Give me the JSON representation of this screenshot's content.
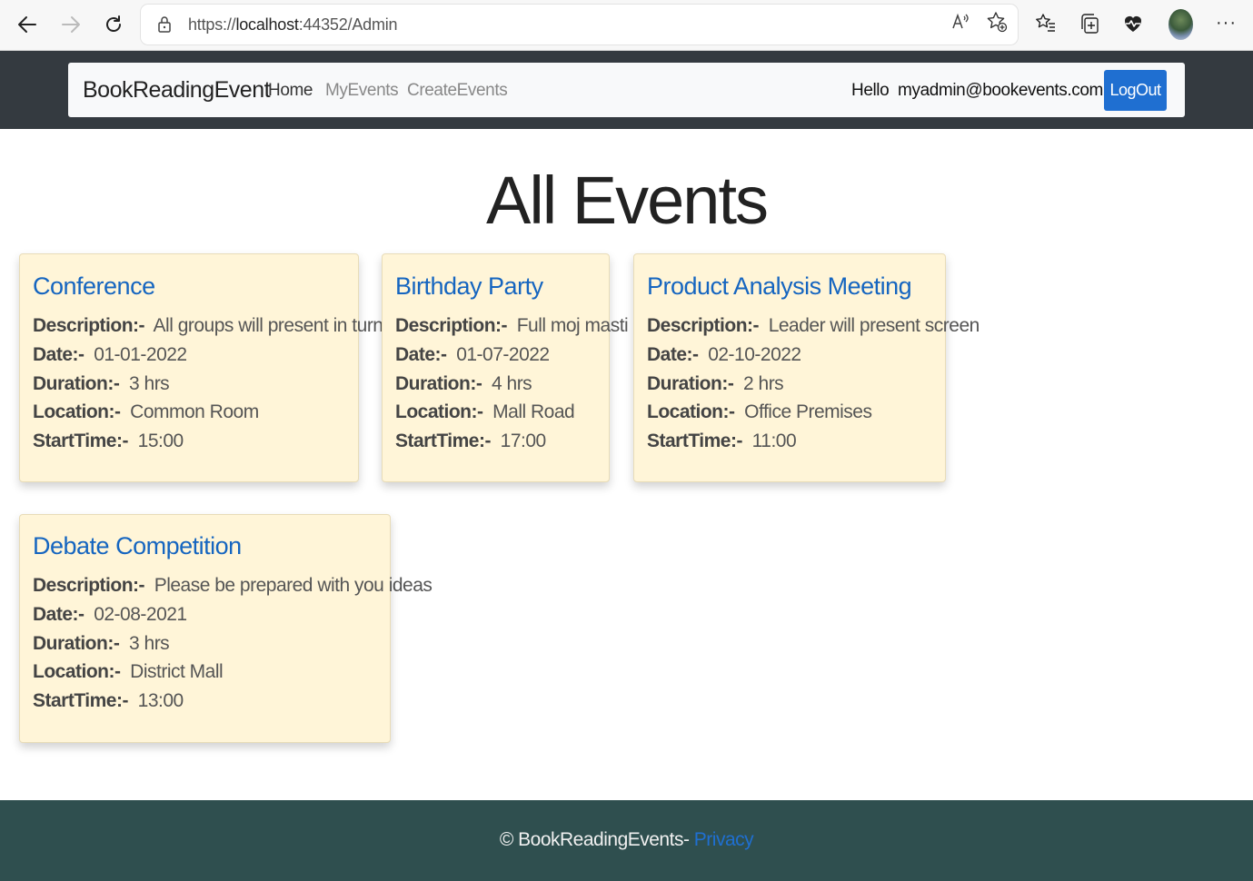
{
  "browser": {
    "url_scheme": "https://",
    "url_host": "localhost",
    "url_rest": ":44352/Admin",
    "icons": [
      "back-icon",
      "forward-icon",
      "refresh-icon",
      "lock-icon",
      "read-aloud-icon",
      "add-favorite-icon",
      "favorites-icon",
      "collections-icon",
      "health-icon",
      "avatar",
      "more-icon"
    ]
  },
  "header": {
    "brand": "BookReadingEvent",
    "nav": {
      "home": "Home",
      "my_events": "MyEvents",
      "create_events": "CreateEvents"
    },
    "greeting": "Hello  myadmin@bookevents.com",
    "logout_label": "LogOut"
  },
  "main": {
    "title": "All Events",
    "labels": {
      "description": "Description:-",
      "date": "Date:-",
      "duration": "Duration:-",
      "location": "Location:-",
      "start_time": "StartTime:-"
    },
    "events": [
      {
        "title": "Conference",
        "description": "All groups will present in turn",
        "date": "01-01-2022",
        "duration": "3 hrs",
        "location": "Common Room",
        "start_time": "15:00"
      },
      {
        "title": "Birthday Party",
        "description": "Full moj masti",
        "date": "01-07-2022",
        "duration": "4 hrs",
        "location": "Mall Road",
        "start_time": "17:00"
      },
      {
        "title": "Product Analysis Meeting",
        "description": "Leader will present screen",
        "date": "02-10-2022",
        "duration": "2 hrs",
        "location": "Office Premises",
        "start_time": "11:00"
      },
      {
        "title": "Debate Competition",
        "description": "Please be prepared with you ideas",
        "date": "02-08-2021",
        "duration": "3 hrs",
        "location": "District Mall",
        "start_time": "13:00"
      }
    ]
  },
  "footer": {
    "text": "© BookReadingEvents- ",
    "privacy_link": "Privacy"
  },
  "colors": {
    "header_bg": "#343a40",
    "card_bg": "#fff5d8",
    "card_title": "#1565c0",
    "logout_bg": "#1f6fd1",
    "footer_bg": "#2f4f4f"
  }
}
